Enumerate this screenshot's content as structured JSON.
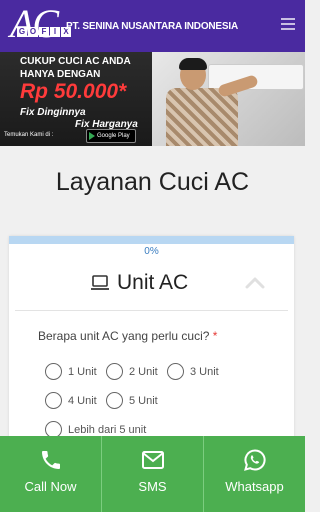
{
  "header": {
    "logo_text": "AC",
    "logo_sub": [
      "G",
      "O",
      "F",
      "I",
      "X"
    ],
    "company_name": "PT. SENINA NUSANTARA INDONESIA",
    "brand_color": "#4a2aa0",
    "menu_icon": "hamburger-menu-icon"
  },
  "banner": {
    "line1": "CUKUP CUCI AC ANDA",
    "line2": "HANYA DENGAN",
    "price": "Rp 50.000*",
    "tagline1": "Fix Dinginnya",
    "tagline2": "Fix Harganya",
    "find_us": "Temukan Kami di :",
    "store_badge": "Google Play",
    "price_color": "#ff3b3b"
  },
  "page": {
    "title": "Layanan Cuci AC"
  },
  "form": {
    "progress_label": "0%",
    "progress_value": 0,
    "section_icon": "laptop-icon",
    "section_title": "Unit AC",
    "collapse_icon": "chevron-up-icon",
    "question": "Berapa unit AC yang perlu cuci?",
    "required_mark": "*",
    "options": [
      "1 Unit",
      "2 Unit",
      "3 Unit",
      "4 Unit",
      "5 Unit",
      "Lebih dari 5 unit"
    ],
    "selected": null
  },
  "bottom_bar": {
    "color": "#4caf50",
    "items": [
      {
        "label": "Call Now",
        "icon": "phone-icon"
      },
      {
        "label": "SMS",
        "icon": "mail-icon"
      },
      {
        "label": "Whatsapp",
        "icon": "whatsapp-icon"
      }
    ]
  }
}
